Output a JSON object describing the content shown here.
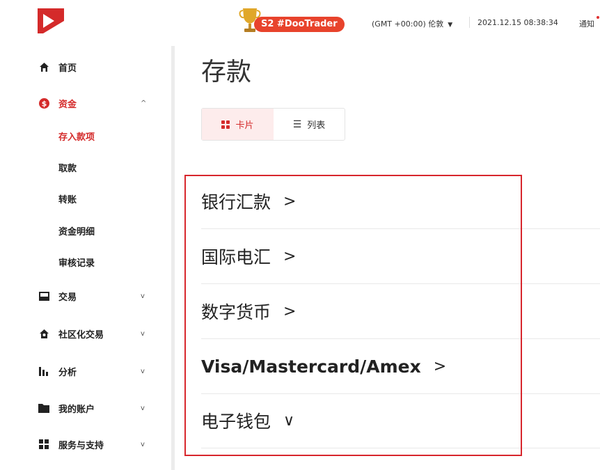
{
  "header": {
    "badge": "S2 #DooTrader",
    "timezone": "(GMT +00:00) 伦敦",
    "datetime": "2021.12.15 08:38:34",
    "notifications_label": "通知"
  },
  "sidebar": {
    "items": [
      {
        "label": "首页",
        "icon": "home-icon"
      },
      {
        "label": "资金",
        "icon": "dollar-icon",
        "chevron": "^"
      },
      {
        "label": "交易",
        "icon": "trade-icon",
        "chevron": "v"
      },
      {
        "label": "社区化交易",
        "icon": "community-icon",
        "chevron": "v"
      },
      {
        "label": "分析",
        "icon": "analysis-icon",
        "chevron": "v"
      },
      {
        "label": "我的账户",
        "icon": "folder-icon",
        "chevron": "v"
      },
      {
        "label": "服务与支持",
        "icon": "support-icon",
        "chevron": "v"
      }
    ],
    "fund_subitems": [
      "存入款项",
      "取款",
      "转账",
      "资金明细",
      "审核记录"
    ]
  },
  "main": {
    "title": "存款",
    "view_toggle": {
      "card": "卡片",
      "list": "列表",
      "selected": "card"
    },
    "methods": [
      {
        "label": "银行汇款",
        "arrow": ">"
      },
      {
        "label": "国际电汇",
        "arrow": ">"
      },
      {
        "label": "数字货币",
        "arrow": ">"
      },
      {
        "label": "Visa/Mastercard/Amex",
        "arrow": ">"
      },
      {
        "label": "电子钱包",
        "arrow": "∨"
      }
    ]
  },
  "colors": {
    "accent": "#d42a2a",
    "highlight_border": "#d7262c",
    "badge": "#e8432c"
  }
}
